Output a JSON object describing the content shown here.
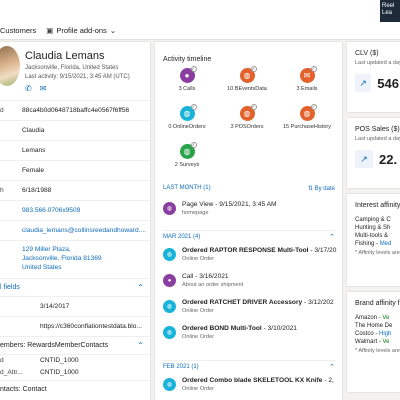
{
  "topbar": {
    "brand_line1": "Reel",
    "brand_line2": "Lea"
  },
  "cmdbar": {
    "customers": "Customers",
    "profile_addons": "Profile add-ons",
    "chevron": "⌄"
  },
  "profile": {
    "name": "Claudia Lemans",
    "location": "Jacksonville, Florida, United States",
    "last_activity": "Last activity: 9/15/2021, 3:45 AM (UTC)"
  },
  "fields": [
    {
      "key": "d",
      "value": "88ca4b0d0648718baffc4e0567f6ff56",
      "link": false
    },
    {
      "key": "",
      "value": "Claudia",
      "link": false
    },
    {
      "key": "",
      "value": "Lemans",
      "link": false
    },
    {
      "key": "",
      "value": "Female",
      "link": false
    },
    {
      "key": "h",
      "value": "6/18/1988",
      "link": false
    },
    {
      "key": "",
      "value": "983.566.0706x9509",
      "link": true
    },
    {
      "key": "",
      "value": "claudia_lemans@collinsreedandhoward....",
      "link": true
    }
  ],
  "address": {
    "line1": "129 Miller Plaza,",
    "line2": "Jacksonville, Florida 81369",
    "line3": "United States"
  },
  "section_fields": "l fields",
  "custom_fields": [
    {
      "key": "",
      "value": "3/14/2017"
    },
    {
      "key": "",
      "value": "https://c360conflationtestdata.blo..."
    }
  ],
  "rewards": {
    "title": "embers: RewardsMemberContacts",
    "rows": [
      {
        "key": "d",
        "value": "CNTID_1000"
      },
      {
        "key": "d_Attr...",
        "value": "CNTID_1000"
      }
    ]
  },
  "contacts_title": "ntacts: Contact",
  "timeline": {
    "title": "Activity timeline",
    "grid": [
      {
        "label": "3 Calls",
        "color": "#8a3fa0",
        "icon": "person"
      },
      {
        "label": "10 BEventsData",
        "color": "#e3612b",
        "icon": "globe"
      },
      {
        "label": "3 Emails",
        "color": "#e3612b",
        "icon": "mail"
      },
      {
        "label": "0 OnlineOrders",
        "color": "#19b3d9",
        "icon": "globe"
      },
      {
        "label": "3 POSOrders",
        "color": "#e3612b",
        "icon": "globe"
      },
      {
        "label": "15 PurchaseHistory",
        "color": "#e3612b",
        "icon": "globe"
      },
      {
        "label": "2 Surveys",
        "color": "#2aa34a",
        "icon": "globe"
      }
    ],
    "last_month": "LAST MONTH (1)",
    "sort": "By date",
    "items_top": [
      {
        "title": "Page View",
        "date": "9/15/2021, 3:45 AM",
        "sub": "homepage",
        "color": "#8a3fa0"
      }
    ],
    "mar_label": "MAR 2021 (4)",
    "items_mar": [
      {
        "title": "Ordered RAPTOR RESPONSE Multi-Tool",
        "date": "3/17/20",
        "sub": "Online Order",
        "color": "#19b3d9"
      },
      {
        "title": "Call",
        "date": "3/16/2021",
        "sub": "About an order shipment",
        "color": "#8a3fa0"
      },
      {
        "title": "Ordered RATCHET DRIVER Accessory",
        "date": "3/12/202",
        "sub": "Online Order",
        "color": "#19b3d9"
      },
      {
        "title": "Ordered BOND Multi-Tool",
        "date": "3/10/2021",
        "sub": "Online Order",
        "color": "#19b3d9"
      }
    ],
    "feb_label": "FEB 2021 (1)",
    "items_feb": [
      {
        "title": "Ordered Combo blade SKELETOOL KX Knife",
        "date": "2,",
        "sub": "Online Order",
        "color": "#19b3d9"
      }
    ]
  },
  "clv": {
    "title": "CLV ($)",
    "sub": "Last updated a day",
    "value": "546"
  },
  "pos": {
    "title": "POS Sales ($)",
    "sub": "Last updated a day",
    "value": "22."
  },
  "interest": {
    "title": "Interest affinity",
    "items": [
      {
        "name": "Camping & C",
        "level": "",
        "hi": false
      },
      {
        "name": "Hunting & Sh",
        "level": "",
        "hi": false
      },
      {
        "name": "Multi-tools &",
        "level": "",
        "hi": false
      },
      {
        "name": "Fishing - ",
        "level": "Med",
        "hi": false
      }
    ],
    "note": "* Affinity levels are"
  },
  "brand": {
    "title": "Brand affinity fo",
    "items": [
      {
        "name": "Amazon - ",
        "level": "Ve",
        "hi": false
      },
      {
        "name": "The Home De",
        "level": "",
        "hi": false
      },
      {
        "name": "Costco - ",
        "level": "High",
        "hi": true
      },
      {
        "name": "Walmart - ",
        "level": "Ve",
        "hi": false
      }
    ],
    "note": "* Affinity levels are"
  }
}
